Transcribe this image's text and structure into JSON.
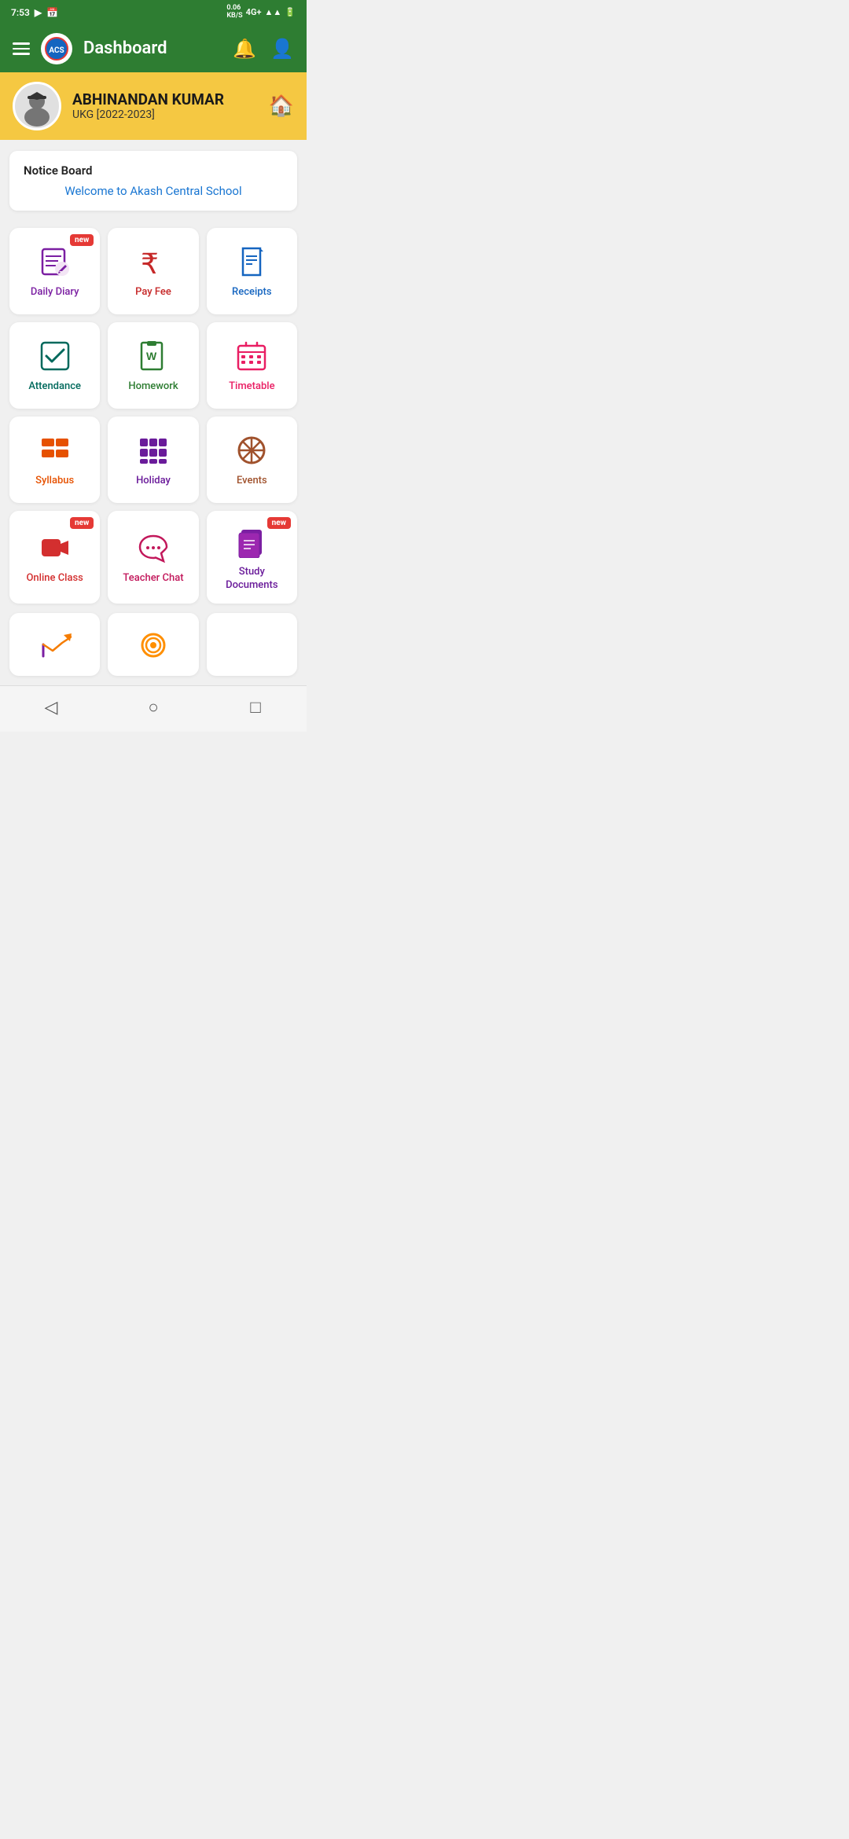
{
  "statusBar": {
    "time": "7:53",
    "speed": "0.06\nKB/S",
    "network": "4G+"
  },
  "nav": {
    "title": "Dashboard",
    "menuIcon": "☰",
    "notificationIcon": "🔔",
    "profileIcon": "👤"
  },
  "profile": {
    "name": "ABHINANDAN KUMAR",
    "class": "UKG [2022-2023]",
    "homeIcon": "🏠"
  },
  "noticeBoard": {
    "title": "Notice Board",
    "message": "Welcome to Akash Central School"
  },
  "gridItems": [
    {
      "id": "daily-diary",
      "label": "Daily Diary",
      "color": "purple",
      "isNew": true
    },
    {
      "id": "pay-fee",
      "label": "Pay Fee",
      "color": "red",
      "isNew": false
    },
    {
      "id": "receipts",
      "label": "Receipts",
      "color": "blue",
      "isNew": false
    },
    {
      "id": "attendance",
      "label": "Attendance",
      "color": "teal",
      "isNew": false
    },
    {
      "id": "homework",
      "label": "Homework",
      "color": "green",
      "isNew": false
    },
    {
      "id": "timetable",
      "label": "Timetable",
      "color": "pink",
      "isNew": false
    },
    {
      "id": "syllabus",
      "label": "Syllabus",
      "color": "orange",
      "isNew": false
    },
    {
      "id": "holiday",
      "label": "Holiday",
      "color": "violet",
      "isNew": false
    },
    {
      "id": "events",
      "label": "Events",
      "color": "brown",
      "isNew": false
    },
    {
      "id": "online-class",
      "label": "Online Class",
      "color": "crimson",
      "isNew": true
    },
    {
      "id": "teacher-chat",
      "label": "Teacher Chat",
      "color": "magenta",
      "isNew": false
    },
    {
      "id": "study-documents",
      "label": "Study\nDocuments",
      "color": "violet",
      "isNew": true
    }
  ],
  "partialItems": [
    {
      "id": "result",
      "label": ""
    },
    {
      "id": "messages",
      "label": ""
    }
  ],
  "bottomNav": {
    "back": "◁",
    "home": "○",
    "recent": "□"
  }
}
